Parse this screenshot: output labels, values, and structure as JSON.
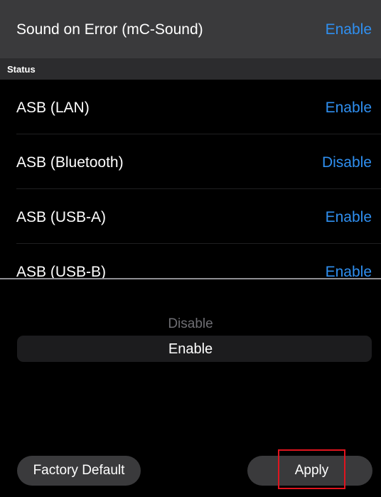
{
  "top_row": {
    "label": "Sound on Error (mC-Sound)",
    "value": "Enable"
  },
  "section": {
    "header": "Status"
  },
  "rows": [
    {
      "label": "ASB (LAN)",
      "value": "Enable"
    },
    {
      "label": "ASB (Bluetooth)",
      "value": "Disable"
    },
    {
      "label": "ASB (USB-A)",
      "value": "Enable"
    },
    {
      "label": "ASB (USB-B)",
      "value": "Enable"
    }
  ],
  "picker": {
    "options": [
      "Disable",
      "Enable"
    ],
    "selected": "Enable"
  },
  "buttons": {
    "factory_default": "Factory Default",
    "apply": "Apply"
  },
  "colors": {
    "accent": "#2f8ff0",
    "highlight_box": "#e0141e"
  }
}
